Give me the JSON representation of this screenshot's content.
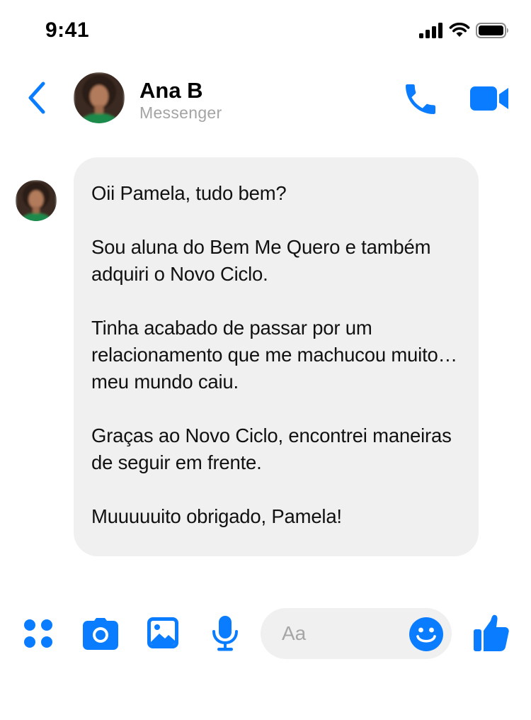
{
  "status_bar": {
    "time": "9:41",
    "icons": [
      "cellular-signal-icon",
      "wifi-icon",
      "battery-icon"
    ]
  },
  "header": {
    "back_icon": "chevron-left-icon",
    "contact_name": "Ana B",
    "contact_subtitle": "Messenger",
    "actions": [
      "phone-icon",
      "video-camera-icon"
    ]
  },
  "message": {
    "paragraphs": [
      "Oii Pamela, tudo bem?",
      "Sou aluna do Bem Me Quero e também adquiri o Novo Ciclo.",
      "Tinha acabado de passar por um relacionamento que me machucou muito… meu mundo caiu.",
      "Graças ao Novo Ciclo, encontrei maneiras de seguir em frente.",
      "Muuuuuito obrigado, Pamela!"
    ]
  },
  "composer": {
    "placeholder": "Aa",
    "icons": [
      "apps-grid-icon",
      "camera-icon",
      "image-icon",
      "microphone-icon",
      "emoji-icon",
      "thumbs-up-icon"
    ]
  },
  "colors": {
    "accent": "#0a7cff",
    "bubble_bg": "#f0f0f0",
    "subtitle": "#a4a4a4"
  }
}
